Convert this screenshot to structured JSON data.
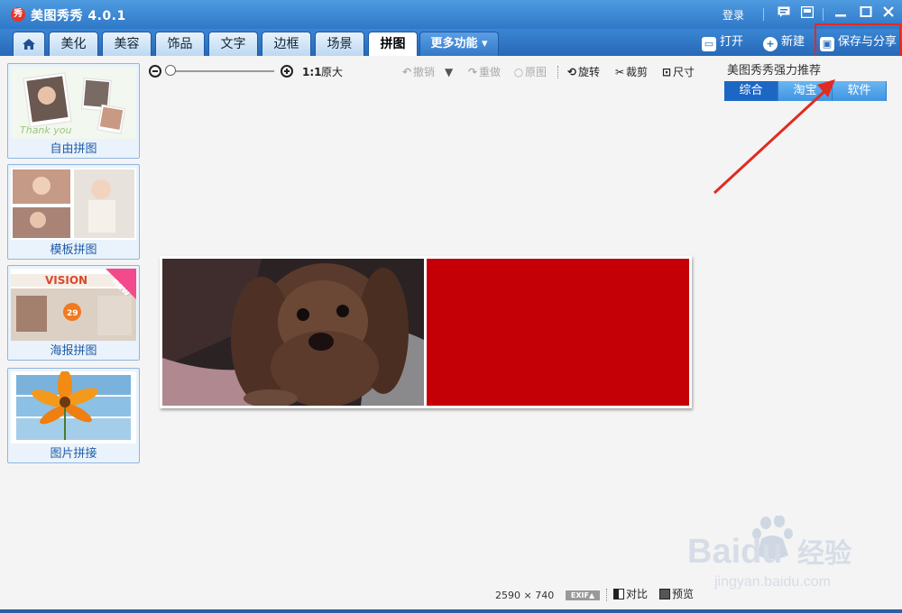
{
  "app": {
    "title": "美图秀秀 4.0.1",
    "logo_text": "秀",
    "login": "登录"
  },
  "tabs": [
    {
      "label": "美化"
    },
    {
      "label": "美容"
    },
    {
      "label": "饰品"
    },
    {
      "label": "文字"
    },
    {
      "label": "边框"
    },
    {
      "label": "场景"
    },
    {
      "label": "拼图"
    },
    {
      "label": "更多功能 ▾"
    }
  ],
  "right_tools": {
    "open": "打开",
    "new": "新建",
    "save": "保存与分享"
  },
  "sidebar": [
    {
      "label": "自由拼图"
    },
    {
      "label": "模板拼图"
    },
    {
      "label": "海报拼图",
      "badge": "new",
      "banner": "VISION"
    },
    {
      "label": "图片拼接"
    }
  ],
  "edit_toolbar": {
    "ratio": "1:1",
    "original_size": "原大",
    "undo": "撤销",
    "redo": "重做",
    "original": "原图",
    "rotate": "旋转",
    "crop": "裁剪",
    "size": "尺寸"
  },
  "recommend": {
    "title": "美图秀秀强力推荐",
    "tabs": [
      "综合",
      "淘宝",
      "软件"
    ],
    "active_tab": 0
  },
  "status": {
    "width": "2590",
    "times": "×",
    "height": "740",
    "exif": "EXIF▲",
    "compare": "对比",
    "preview": "预览"
  },
  "watermark": {
    "brand": "Baidu",
    "brand_cn": "经验",
    "url": "jingyan.baidu.com"
  },
  "colors": {
    "annotation": "#e02b20",
    "collage_right": "#c40006",
    "accent": "#2f78c8"
  }
}
